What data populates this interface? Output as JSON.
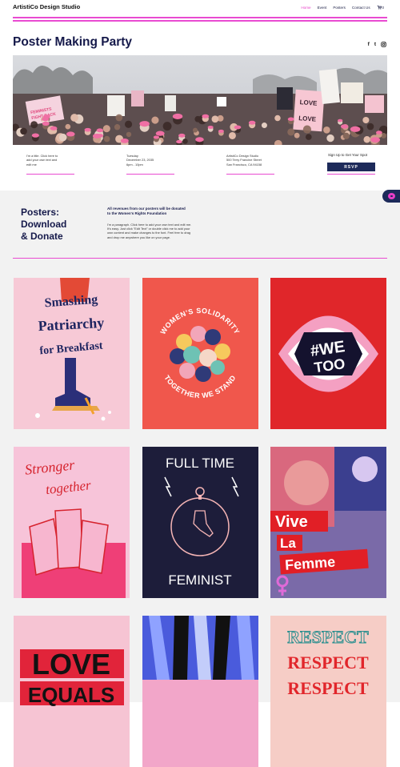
{
  "header": {
    "brand": "ArtistiCo Design Studio",
    "nav": [
      {
        "label": "Home",
        "active": true
      },
      {
        "label": "Event",
        "active": false
      },
      {
        "label": "Posters",
        "active": false
      },
      {
        "label": "Contact Us",
        "active": false
      }
    ],
    "cart_count": "0"
  },
  "event": {
    "title": "Poster Making Party",
    "social": [
      "f",
      "t",
      "ig"
    ],
    "info_1": [
      "I'm a title. Click here to",
      "add your own text and",
      "edit me"
    ],
    "info_2": [
      "Tuesday",
      "December 23, 2035",
      "6pm - 10pm"
    ],
    "info_3": [
      "ArtistiCo Design Studio",
      "500 Terry Francine Street",
      "San Francisco, CA 94158"
    ],
    "signup": "Sign Up to Get Your Spot",
    "rsvp": "RSVP"
  },
  "donate": {
    "heading": [
      "Posters:",
      "Download",
      "& Donate"
    ],
    "lead": [
      "All revenues from our posters will be donated",
      "to the Women's Rights Foundation"
    ],
    "paragraph": [
      "I'm a paragraph. Click here to add your own text and edit me.",
      "It's easy. Just click \"Edit Text\" or double click me to add your",
      "own content and make changes to the font. Feel free to drag",
      "and drop me anywhere you like on your page."
    ]
  },
  "posters": [
    {
      "lines": [
        "Smashing",
        "Patriarchy",
        "for Breakfast"
      ]
    },
    {
      "lines": [
        "WOMEN'S SOLIDARITY",
        "TOGETHER WE STAND"
      ]
    },
    {
      "lines": [
        "#WE",
        "TOO"
      ]
    },
    {
      "lines": [
        "Stronger",
        "together"
      ]
    },
    {
      "lines": [
        "FULL TIME",
        "FEMINIST"
      ]
    },
    {
      "lines": [
        "Vive",
        "La",
        "Femme"
      ]
    },
    {
      "lines": [
        "LOVE",
        "EQUALS"
      ]
    },
    {
      "lines": []
    },
    {
      "lines": [
        "RESPECT",
        "RESPECT",
        "RESPECT"
      ]
    }
  ],
  "colors": {
    "accent": "#e94bd1",
    "navy": "#15194a",
    "button": "#1d2a5a"
  }
}
